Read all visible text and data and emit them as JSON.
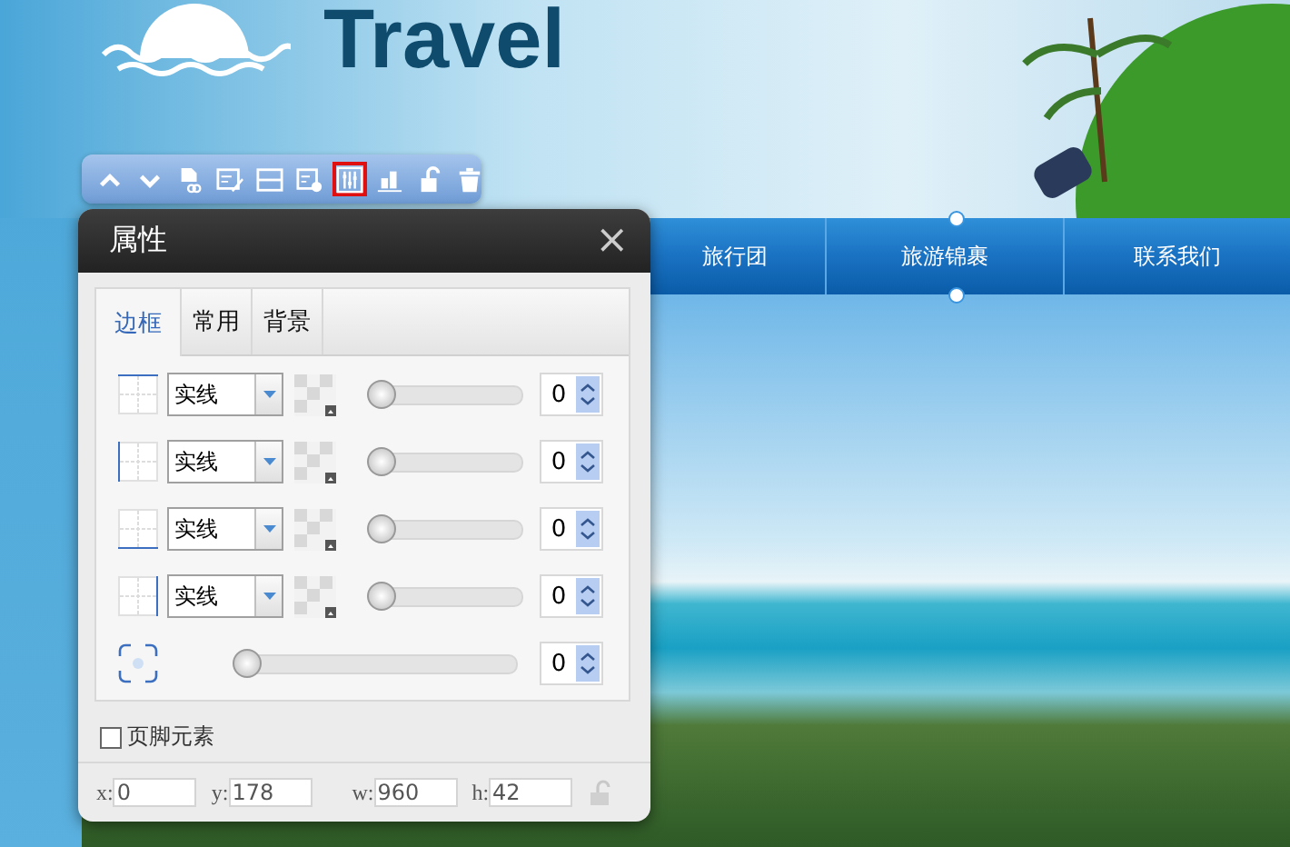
{
  "header": {
    "logo_text": "Travel"
  },
  "nav": {
    "items": [
      {
        "label": "旅行团"
      },
      {
        "label": "旅游锦裹"
      },
      {
        "label": "联系我们"
      }
    ]
  },
  "toolbar": {
    "buttons": [
      {
        "kind": "up",
        "selected": false
      },
      {
        "kind": "down",
        "selected": false
      },
      {
        "kind": "page-link",
        "selected": false
      },
      {
        "kind": "edit",
        "selected": false
      },
      {
        "kind": "rows",
        "selected": false
      },
      {
        "kind": "page-settings",
        "selected": false
      },
      {
        "kind": "sliders",
        "selected": true
      },
      {
        "kind": "bars",
        "selected": false
      },
      {
        "kind": "unlock",
        "selected": false
      },
      {
        "kind": "trash",
        "selected": false
      }
    ]
  },
  "panel": {
    "title": "属性",
    "close": "×",
    "tabs": [
      {
        "label": "边框",
        "selected": true
      },
      {
        "label": "常用",
        "selected": false
      },
      {
        "label": "背景",
        "selected": false
      }
    ],
    "border_rows": [
      {
        "kind": "top",
        "style": "实线",
        "level": 0,
        "value": "0"
      },
      {
        "kind": "left",
        "style": "实线",
        "level": 0,
        "value": "0"
      },
      {
        "kind": "bottom",
        "style": "实线",
        "level": 0,
        "value": "0"
      },
      {
        "kind": "right",
        "style": "实线",
        "level": 0,
        "value": "0"
      }
    ],
    "radius_row": {
      "level": 0,
      "value": "0"
    },
    "footer_element": {
      "label": "页脚元素",
      "checked": false
    },
    "fields": [
      {
        "label": "x:",
        "value": "0"
      },
      {
        "label": "y:",
        "value": "178"
      },
      {
        "label": "w:",
        "value": "960"
      },
      {
        "label": "h:",
        "value": "42"
      }
    ],
    "locked": false
  }
}
